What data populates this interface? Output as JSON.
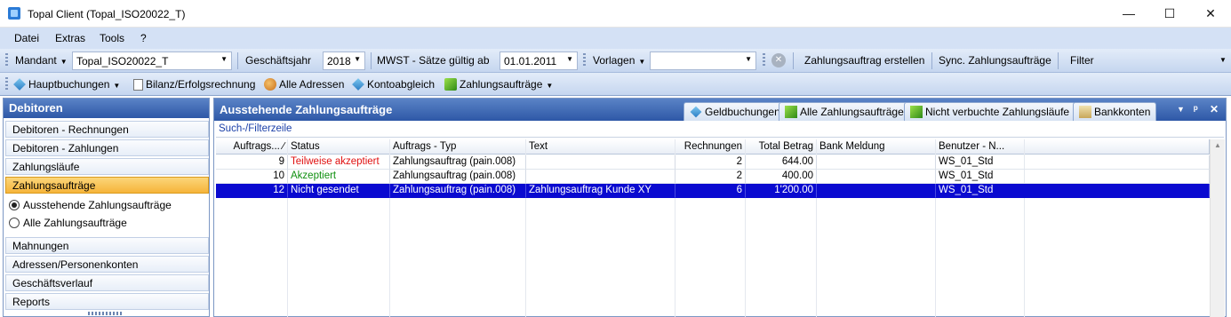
{
  "window": {
    "title": "Topal Client (Topal_ISO20022_T)",
    "minimize": "—",
    "maximize": "☐",
    "close": "✕"
  },
  "menu": [
    "Datei",
    "Extras",
    "Tools",
    "?"
  ],
  "toolbar1": {
    "mandant_label": "Mandant",
    "mandant_value": "Topal_ISO20022_T",
    "geschaeftsjahr_label": "Geschäftsjahr",
    "geschaeftsjahr_value": "2018",
    "mwst_label": "MWST - Sätze gültig ab",
    "mwst_value": "01.01.2011",
    "vorlagen_label": "Vorlagen",
    "vorlagen_value": "",
    "zahlungsauftrag_erstellen": "Zahlungsauftrag erstellen",
    "sync": "Sync. Zahlungsaufträge",
    "filter": "Filter"
  },
  "toolbar2": {
    "hauptbuchungen": "Hauptbuchungen",
    "bilanz": "Bilanz/Erfolgsrechnung",
    "alle_adressen": "Alle Adressen",
    "kontoabgleich": "Kontoabgleich",
    "zahlungsauftraege": "Zahlungsaufträge"
  },
  "sidebar": {
    "header": "Debitoren",
    "items_top": [
      "Debitoren - Rechnungen",
      "Debitoren - Zahlungen",
      "Zahlungsläufe",
      "Zahlungsaufträge"
    ],
    "active_index": 3,
    "radios": [
      {
        "label": "Ausstehende Zahlungsaufträge",
        "checked": true
      },
      {
        "label": "Alle Zahlungsaufträge",
        "checked": false
      }
    ],
    "items_bottom": [
      "Mahnungen",
      "Adressen/Personenkonten",
      "Geschäftsverlauf",
      "Reports"
    ]
  },
  "main": {
    "title": "Ausstehende Zahlungsaufträge",
    "tabs": [
      "Geldbuchungen",
      "Alle Zahlungsaufträge",
      "Nicht verbuchte Zahlungsläufe",
      "Bankkonten"
    ],
    "controls": {
      "dropdown": "▼",
      "pin": "ᵖ",
      "close": "✕"
    },
    "filter_line": "Such-/Filterzeile",
    "columns": [
      "Auftrags... ∕",
      "Status",
      "Auftrags - Typ",
      "Text",
      "Rechnungen",
      "Total Betrag",
      "Bank Meldung",
      "Benutzer - N..."
    ],
    "rows": [
      {
        "nr": "9",
        "status": "Teilweise akzeptiert",
        "status_color": "#e01010",
        "typ": "Zahlungsauftrag (pain.008)",
        "text": "",
        "rechnungen": "2",
        "betrag": "644.00",
        "bank": "",
        "benutzer": "WS_01_Std",
        "selected": false
      },
      {
        "nr": "10",
        "status": "Akzeptiert",
        "status_color": "#109010",
        "typ": "Zahlungsauftrag (pain.008)",
        "text": "",
        "rechnungen": "2",
        "betrag": "400.00",
        "bank": "",
        "benutzer": "WS_01_Std",
        "selected": false
      },
      {
        "nr": "12",
        "status": "Nicht gesendet",
        "status_color": "#ffffff",
        "typ": "Zahlungsauftrag (pain.008)",
        "text": "Zahlungsauftrag Kunde XY",
        "rechnungen": "6",
        "betrag": "1'200.00",
        "bank": "",
        "benutzer": "WS_01_Std",
        "selected": true
      }
    ]
  },
  "colors": {
    "accent": "#2e58a7",
    "selection": "#0a0ad0",
    "active_item": "#f6b43a"
  }
}
